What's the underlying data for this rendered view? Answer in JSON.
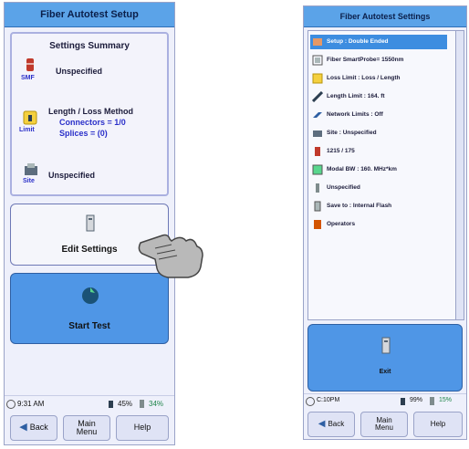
{
  "left": {
    "title": "Fiber Autotest Setup",
    "summary_title": "Settings Summary",
    "rows": [
      {
        "icon": "fiber-type-icon",
        "caption": "SMF",
        "text": "Unspecified"
      },
      {
        "icon": "limit-icon",
        "caption": "Limit",
        "text": "Length / Loss Method",
        "sub1": "Connectors = 1/0",
        "sub2": "Splices = (0)"
      },
      {
        "icon": "site-icon",
        "caption": "Site",
        "text": "Unspecified"
      }
    ],
    "edit_button": "Edit Settings",
    "start_button": "Start Test",
    "status": {
      "time": "9:31 AM",
      "battery": "45%",
      "memory": "34%"
    },
    "nav": {
      "back": "Back",
      "main_menu": "Main\nMenu",
      "help": "Help"
    }
  },
  "right": {
    "title": "Fiber Autotest Settings",
    "items": [
      "Setup : Double Ended",
      "Fiber SmartProbe= 1550nm",
      "Loss Limit : Loss / Length",
      "Length Limit : 164. ft",
      "Network Limits : Off",
      "Site : Unspecified",
      "1215 / 175",
      "Modal BW : 160. MHz*km",
      "Unspecified",
      "Save to : Internal Flash",
      "Operators"
    ],
    "bottom_button": "Exit",
    "status": {
      "time": "C:10PM",
      "battery": "99%",
      "memory": "15%"
    },
    "nav": {
      "back": "Back",
      "main_menu": "Main\nMenu",
      "help": "Help"
    }
  },
  "colors": {
    "title_bar": "#5ba3e8",
    "start_button": "#4f96e6",
    "highlight": "#3d8de0"
  }
}
